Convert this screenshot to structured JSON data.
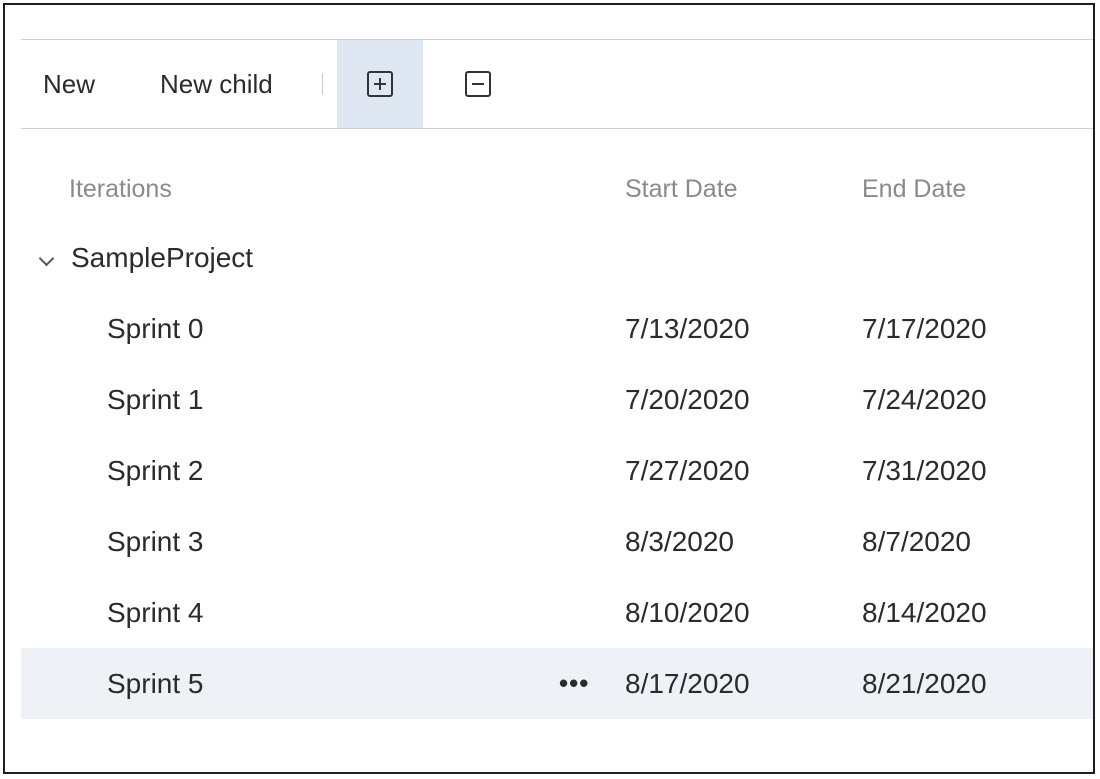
{
  "toolbar": {
    "new_label": "New",
    "new_child_label": "New child",
    "expand_icon": "expand-all-icon",
    "collapse_icon": "collapse-all-icon"
  },
  "columns": {
    "iterations": "Iterations",
    "start_date": "Start Date",
    "end_date": "End Date"
  },
  "tree": {
    "root_label": "SampleProject",
    "rows": [
      {
        "name": "Sprint 0",
        "start": "7/13/2020",
        "end": "7/17/2020"
      },
      {
        "name": "Sprint 1",
        "start": "7/20/2020",
        "end": "7/24/2020"
      },
      {
        "name": "Sprint 2",
        "start": "7/27/2020",
        "end": "7/31/2020"
      },
      {
        "name": "Sprint 3",
        "start": "8/3/2020",
        "end": "8/7/2020"
      },
      {
        "name": "Sprint 4",
        "start": "8/10/2020",
        "end": "8/14/2020"
      },
      {
        "name": "Sprint 5",
        "start": "8/17/2020",
        "end": "8/21/2020",
        "selected": true
      }
    ],
    "more_glyph": "•••"
  },
  "colors": {
    "selected_row_bg": "#eef2f7",
    "active_toolbar_bg": "#dfe8f2",
    "text": "#2b2b2b",
    "header_text": "#8a8a8a"
  }
}
